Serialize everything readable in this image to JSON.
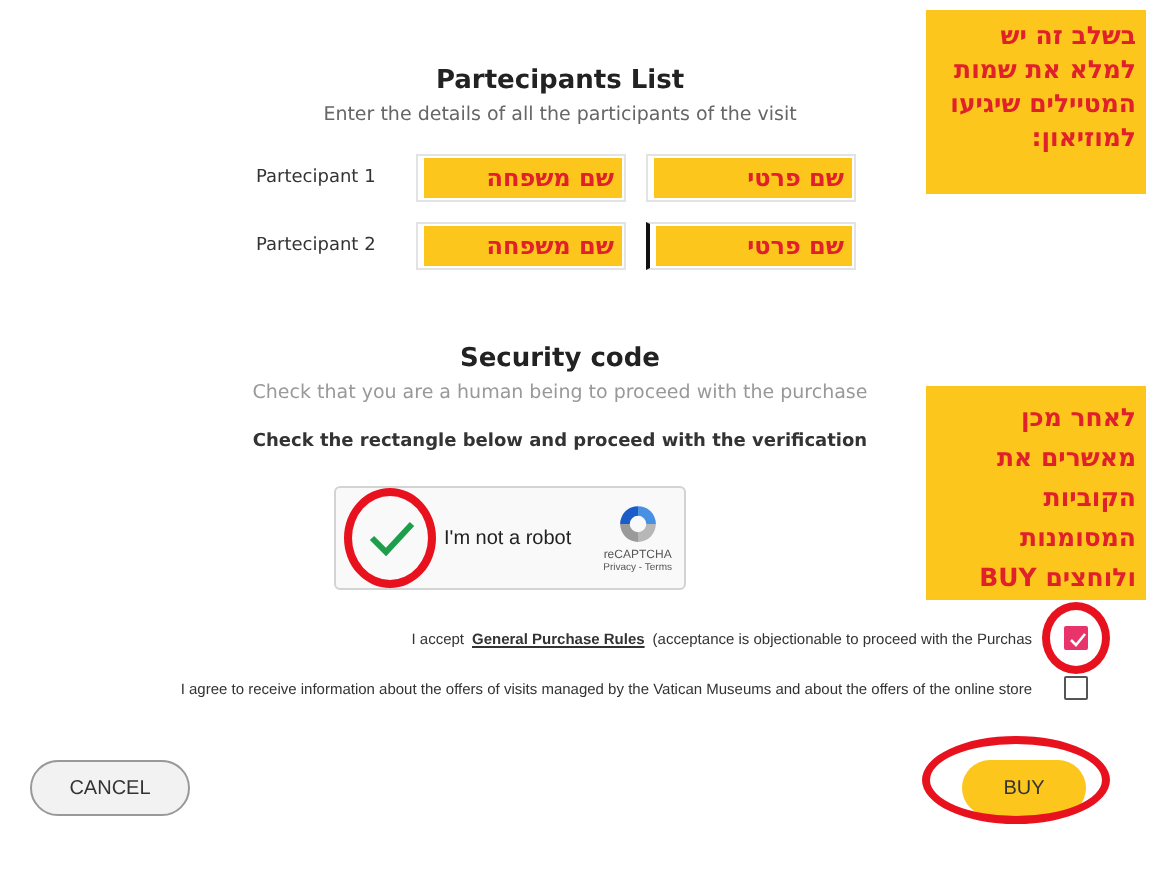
{
  "participants_section": {
    "title": "Partecipants List",
    "subtitle": "Enter the details of all the participants of the visit",
    "rows": [
      {
        "label": "Partecipant 1",
        "fields": [
          {
            "note": "שם פרטי",
            "focused": false
          },
          {
            "note": "שם משפחה",
            "focused": false
          }
        ]
      },
      {
        "label": "Partecipant 2",
        "fields": [
          {
            "note": "שם פרטי",
            "focused": true
          },
          {
            "note": "שם משפחה",
            "focused": false
          }
        ]
      }
    ]
  },
  "security_section": {
    "title": "Security code",
    "subtitle": "Check that you are a human being to proceed with the purchase",
    "instruction": "Check the rectangle below and proceed with the verification",
    "captcha": {
      "checked": true,
      "highlighted": true,
      "label": "I'm not a robot",
      "brand": "reCAPTCHA",
      "links": "Privacy - Terms"
    }
  },
  "consents": [
    {
      "before": "I accept",
      "link": "General Purchase Rules",
      "after": "(acceptance is objectionable to proceed with the Purchas",
      "checked": true,
      "highlighted": true
    },
    {
      "before": "I agree to receive information about the offers of visits managed by the Vatican Museums and about the offers of the online store",
      "checked": false,
      "highlighted": false
    }
  ],
  "buttons": [
    {
      "label": "BUY",
      "kind": "primary",
      "highlighted": true
    },
    {
      "label": "CANCEL",
      "kind": "secondary",
      "highlighted": false
    }
  ],
  "annotations": [
    {
      "text": "בשלב זה יש למלא את שמות המטיילים שיגיעו למוזיאון:"
    },
    {
      "text": "לאחר מכן מאשרים את הקוביות המסומנות ולוחצים BUY"
    }
  ]
}
